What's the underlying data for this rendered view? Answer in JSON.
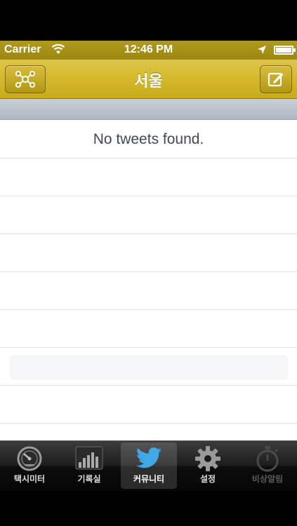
{
  "status_bar": {
    "carrier": "Carrier",
    "time": "12:46 PM",
    "wifi_icon": "wifi-icon",
    "location_icon": "location-arrow-icon",
    "battery_level": 1.0
  },
  "nav": {
    "title": "서울",
    "left_button_icon": "network-nodes-icon",
    "right_button_icon": "compose-icon",
    "bar_color": "#d6ba2d"
  },
  "list": {
    "empty_message": "No tweets found."
  },
  "tabs": [
    {
      "label": "택시미터",
      "icon": "speedometer-icon",
      "state": "normal"
    },
    {
      "label": "기록실",
      "icon": "bar-chart-icon",
      "state": "normal"
    },
    {
      "label": "커뮤니티",
      "icon": "twitter-bird-icon",
      "state": "selected"
    },
    {
      "label": "설정",
      "icon": "gear-icon",
      "state": "normal"
    },
    {
      "label": "비상알림",
      "icon": "stopwatch-icon",
      "state": "disabled"
    }
  ],
  "colors": {
    "accent": "#d6ba2d",
    "status_bar": "#a68f14",
    "twitter_blue": "#3fa8e6"
  }
}
